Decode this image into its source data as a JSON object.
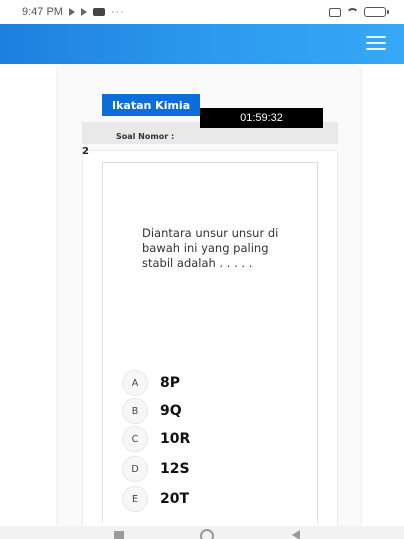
{
  "status_bar": {
    "time": "9:47 PM",
    "dots": "···"
  },
  "header": {
    "menu_icon": "hamburger-menu-icon",
    "accent_color": "#1e7fde"
  },
  "exam": {
    "subject": "Ikatan Kimia",
    "timer": "01:59:32",
    "soal_label": "Soal Nomor :",
    "soal_number": "2",
    "question": "Diantara unsur unsur di bawah ini yang paling stabil adalah . . . . .",
    "options": [
      {
        "letter": "A",
        "text": "8P"
      },
      {
        "letter": "B",
        "text": "9Q"
      },
      {
        "letter": "C",
        "text": "10R"
      },
      {
        "letter": "D",
        "text": "12S"
      },
      {
        "letter": "E",
        "text": "20T"
      }
    ]
  }
}
